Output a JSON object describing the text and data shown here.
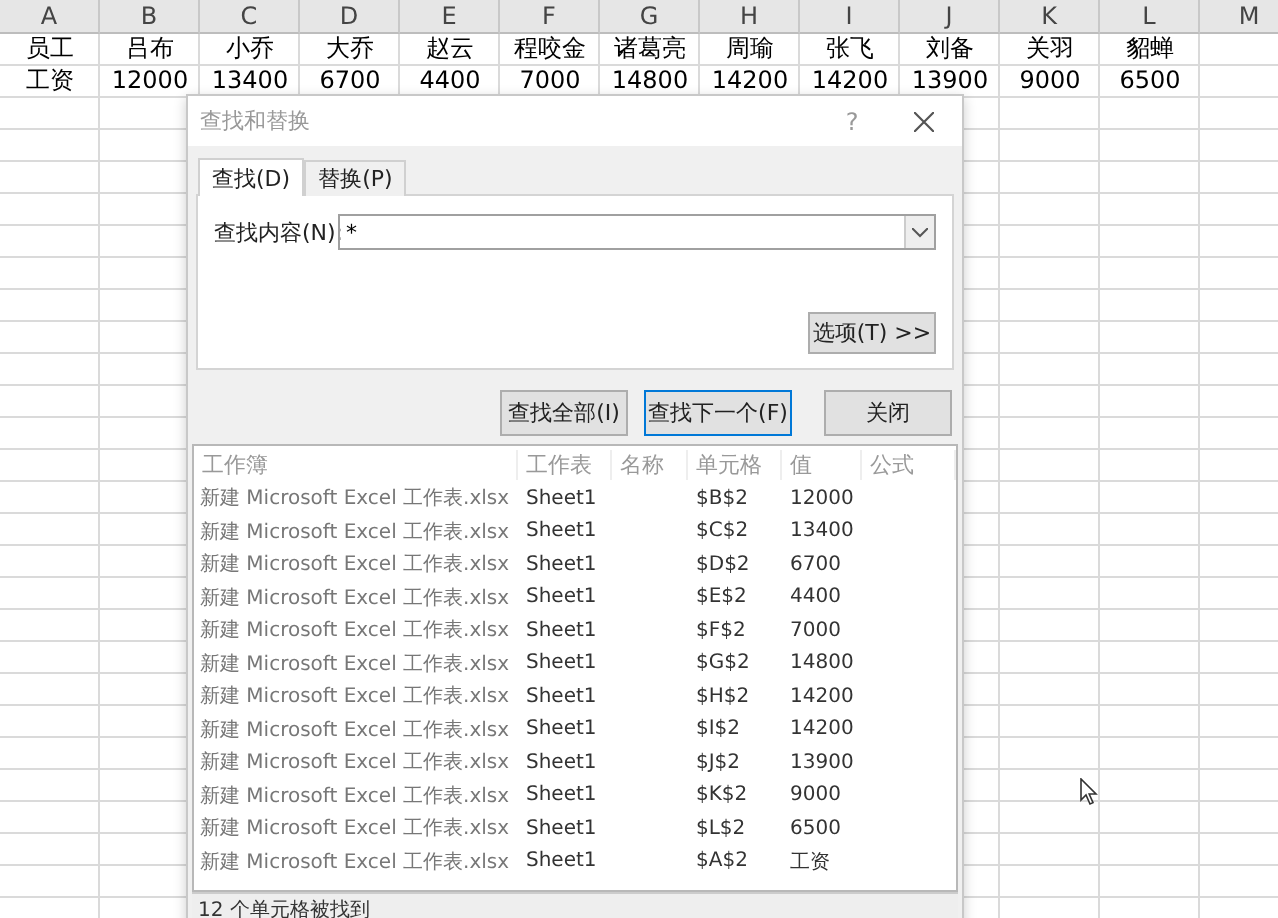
{
  "spreadsheet": {
    "columns": [
      "A",
      "B",
      "C",
      "D",
      "E",
      "F",
      "G",
      "H",
      "I",
      "J",
      "K",
      "L",
      "M"
    ],
    "rows": [
      [
        "员工",
        "吕布",
        "小乔",
        "大乔",
        "赵云",
        "程咬金",
        "诸葛亮",
        "周瑜",
        "张飞",
        "刘备",
        "关羽",
        "貂蝉"
      ],
      [
        "工资",
        "12000",
        "13400",
        "6700",
        "4400",
        "7000",
        "14800",
        "14200",
        "14200",
        "13900",
        "9000",
        "6500"
      ]
    ]
  },
  "dialog": {
    "title": "查找和替换",
    "help": "?",
    "tabs": [
      {
        "label": "查找(D)",
        "selected": true
      },
      {
        "label": "替换(P)",
        "selected": false
      }
    ],
    "find_label": "查找内容(N):",
    "find_value": "*",
    "options_button": "选项(T) >>",
    "buttons": [
      {
        "label": "查找全部(I)",
        "focused": false
      },
      {
        "label": "查找下一个(F)",
        "focused": true
      },
      {
        "label": "关闭",
        "focused": false
      }
    ],
    "results": {
      "columns": [
        "工作簿",
        "工作表",
        "名称",
        "单元格",
        "值",
        "公式"
      ],
      "rows": [
        [
          "新建 Microsoft Excel 工作表.xlsx",
          "Sheet1",
          "",
          "$B$2",
          "12000",
          ""
        ],
        [
          "新建 Microsoft Excel 工作表.xlsx",
          "Sheet1",
          "",
          "$C$2",
          "13400",
          ""
        ],
        [
          "新建 Microsoft Excel 工作表.xlsx",
          "Sheet1",
          "",
          "$D$2",
          "6700",
          ""
        ],
        [
          "新建 Microsoft Excel 工作表.xlsx",
          "Sheet1",
          "",
          "$E$2",
          "4400",
          ""
        ],
        [
          "新建 Microsoft Excel 工作表.xlsx",
          "Sheet1",
          "",
          "$F$2",
          "7000",
          ""
        ],
        [
          "新建 Microsoft Excel 工作表.xlsx",
          "Sheet1",
          "",
          "$G$2",
          "14800",
          ""
        ],
        [
          "新建 Microsoft Excel 工作表.xlsx",
          "Sheet1",
          "",
          "$H$2",
          "14200",
          ""
        ],
        [
          "新建 Microsoft Excel 工作表.xlsx",
          "Sheet1",
          "",
          "$I$2",
          "14200",
          ""
        ],
        [
          "新建 Microsoft Excel 工作表.xlsx",
          "Sheet1",
          "",
          "$J$2",
          "13900",
          ""
        ],
        [
          "新建 Microsoft Excel 工作表.xlsx",
          "Sheet1",
          "",
          "$K$2",
          "9000",
          ""
        ],
        [
          "新建 Microsoft Excel 工作表.xlsx",
          "Sheet1",
          "",
          "$L$2",
          "6500",
          ""
        ],
        [
          "新建 Microsoft Excel 工作表.xlsx",
          "Sheet1",
          "",
          "$A$2",
          "工资",
          ""
        ]
      ]
    },
    "status": "12 个单元格被找到"
  }
}
